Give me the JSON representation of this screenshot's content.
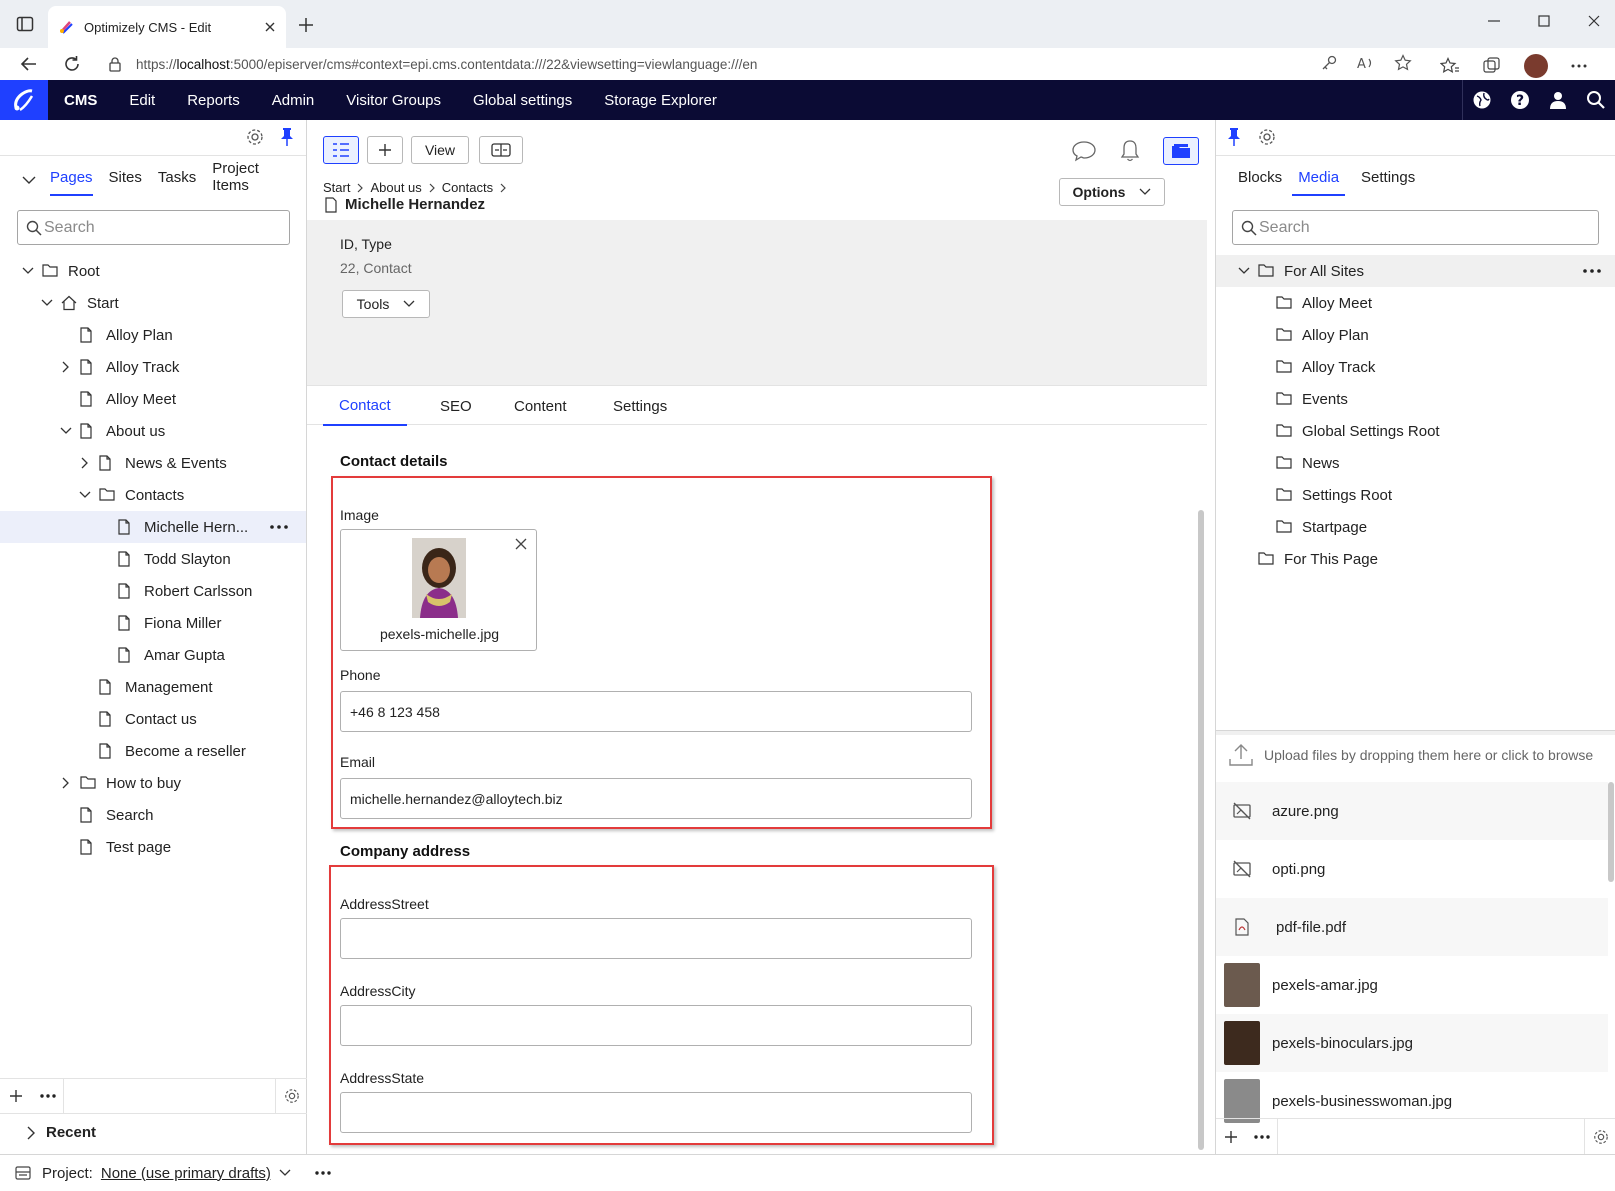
{
  "browser": {
    "tab_title": "Optimizely CMS - Edit",
    "url_prefix": "https://",
    "url_host": "localhost",
    "url_rest": ":5000/episerver/cms#context=epi.cms.contentdata:///22&viewsetting=viewlanguage:///en"
  },
  "nav": {
    "items": [
      "CMS",
      "Edit",
      "Reports",
      "Admin",
      "Visitor Groups",
      "Global settings",
      "Storage Explorer"
    ]
  },
  "left": {
    "tabs": [
      "Pages",
      "Sites",
      "Tasks",
      "Project Items"
    ],
    "search_placeholder": "Search",
    "tree": [
      {
        "label": "Root",
        "depth": 0,
        "chev": "down",
        "icon": "folder"
      },
      {
        "label": "Start",
        "depth": 1,
        "chev": "down",
        "icon": "home"
      },
      {
        "label": "Alloy Plan",
        "depth": 2,
        "chev": "",
        "icon": "page"
      },
      {
        "label": "Alloy Track",
        "depth": 2,
        "chev": "right",
        "icon": "page"
      },
      {
        "label": "Alloy Meet",
        "depth": 2,
        "chev": "",
        "icon": "page"
      },
      {
        "label": "About us",
        "depth": 2,
        "chev": "down",
        "icon": "page"
      },
      {
        "label": "News & Events",
        "depth": 3,
        "chev": "right",
        "icon": "page"
      },
      {
        "label": "Contacts",
        "depth": 3,
        "chev": "down",
        "icon": "folder"
      },
      {
        "label": "Michelle Hern...",
        "depth": 4,
        "chev": "",
        "icon": "page",
        "selected": true
      },
      {
        "label": "Todd Slayton",
        "depth": 4,
        "chev": "",
        "icon": "page"
      },
      {
        "label": "Robert Carlsson",
        "depth": 4,
        "chev": "",
        "icon": "page"
      },
      {
        "label": "Fiona Miller",
        "depth": 4,
        "chev": "",
        "icon": "page"
      },
      {
        "label": "Amar Gupta",
        "depth": 4,
        "chev": "",
        "icon": "page"
      },
      {
        "label": "Management",
        "depth": 3,
        "chev": "",
        "icon": "page"
      },
      {
        "label": "Contact us",
        "depth": 3,
        "chev": "",
        "icon": "page"
      },
      {
        "label": "Become a reseller",
        "depth": 3,
        "chev": "",
        "icon": "page"
      },
      {
        "label": "How to buy",
        "depth": 2,
        "chev": "right",
        "icon": "folder"
      },
      {
        "label": "Search",
        "depth": 2,
        "chev": "",
        "icon": "page"
      },
      {
        "label": "Test page",
        "depth": 2,
        "chev": "",
        "icon": "page"
      }
    ],
    "recent_label": "Recent"
  },
  "editor": {
    "view_label": "View",
    "options_label": "Options",
    "breadcrumb": [
      "Start",
      "About us",
      "Contacts"
    ],
    "page_title": "Michelle Hernandez",
    "id_type_label": "ID, Type",
    "id_type_value": "22, Contact",
    "tools_label": "Tools",
    "tabs": [
      "Contact",
      "SEO",
      "Content",
      "Settings"
    ],
    "contact_section": "Contact details",
    "image_label": "Image",
    "image_filename": "pexels-michelle.jpg",
    "phone_label": "Phone",
    "phone_value": "+46 8 123 458",
    "email_label": "Email",
    "email_value": "michelle.hernandez@alloytech.biz",
    "address_section": "Company address",
    "street_label": "AddressStreet",
    "city_label": "AddressCity",
    "state_label": "AddressState"
  },
  "right": {
    "tabs": [
      "Blocks",
      "Media",
      "Settings"
    ],
    "search_placeholder": "Search",
    "tree": [
      {
        "label": "For All Sites",
        "depth": 0
      },
      {
        "label": "Alloy Meet",
        "depth": 1
      },
      {
        "label": "Alloy Plan",
        "depth": 1
      },
      {
        "label": "Alloy Track",
        "depth": 1
      },
      {
        "label": "Events",
        "depth": 1
      },
      {
        "label": "Global Settings Root",
        "depth": 1
      },
      {
        "label": "News",
        "depth": 1
      },
      {
        "label": "Settings Root",
        "depth": 1
      },
      {
        "label": "Startpage",
        "depth": 1
      },
      {
        "label": "For This Page",
        "depth": 0
      }
    ],
    "upload_text": "Upload files by dropping them here or click to browse",
    "media": [
      {
        "name": "azure.png",
        "kind": "noimage"
      },
      {
        "name": "opti.png",
        "kind": "noimage"
      },
      {
        "name": "pdf-file.pdf",
        "kind": "pdf"
      },
      {
        "name": "pexels-amar.jpg",
        "kind": "photo",
        "color": "#6b5a4e"
      },
      {
        "name": "pexels-binoculars.jpg",
        "kind": "photo",
        "color": "#3d2a1e"
      },
      {
        "name": "pexels-businesswoman.jpg",
        "kind": "photo",
        "color": "#8a8a8a"
      }
    ]
  },
  "footer": {
    "project_label": "Project:",
    "project_value": "None (use primary drafts)"
  },
  "colors": {
    "accent": "#1f40ff",
    "nav_bg": "#0b0b34",
    "highlight_box": "#e33b3b"
  }
}
